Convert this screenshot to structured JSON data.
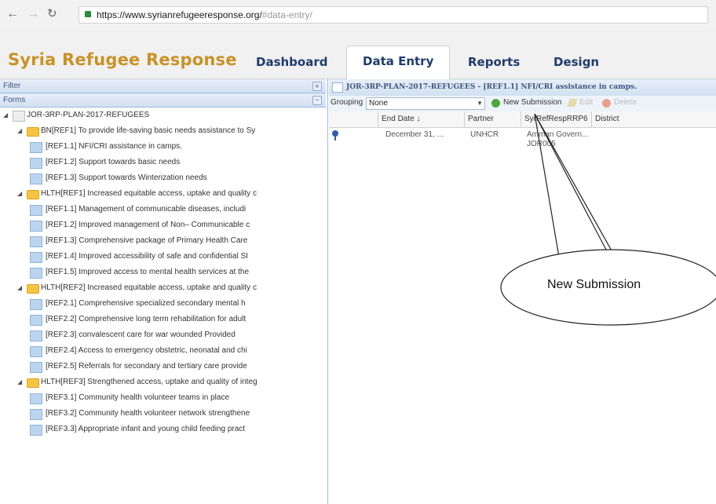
{
  "browser": {
    "url_main": "https://www.syrianrefugeeresponse.org/",
    "url_fragment": "#data-entry/"
  },
  "header": {
    "app_title": "Syria Refugee Response",
    "tabs": [
      "Dashboard",
      "Data Entry",
      "Reports",
      "Design"
    ],
    "active_tab": "Data Entry"
  },
  "left_panel": {
    "filter_title": "Filter",
    "forms_title": "Forms",
    "tree": [
      {
        "level": 0,
        "type": "root",
        "text": "JOR-3RP-PLAN-2017-REFUGEES"
      },
      {
        "level": 1,
        "type": "folder",
        "text": "BN[REF1] To provide life-saving basic needs assistance to Sy"
      },
      {
        "level": 2,
        "type": "form",
        "text": "[REF1.1] NFI/CRI assistance in camps."
      },
      {
        "level": 2,
        "type": "form",
        "text": "[REF1.2] Support towards basic needs"
      },
      {
        "level": 2,
        "type": "form",
        "text": "[REF1.3] Support towards Winterization needs"
      },
      {
        "level": 1,
        "type": "folder",
        "text": "HLTH[REF1] Increased equitable access, uptake and quality c"
      },
      {
        "level": 2,
        "type": "form",
        "text": "[REF1.1] Management of communicable diseases, includi"
      },
      {
        "level": 2,
        "type": "form",
        "text": "[REF1.2] Improved management of Non– Communicable c"
      },
      {
        "level": 2,
        "type": "form",
        "text": "[REF1.3] Comprehensive package of Primary Health Care"
      },
      {
        "level": 2,
        "type": "form",
        "text": "[REF1.4] Improved accessibility of safe and confidential SI"
      },
      {
        "level": 2,
        "type": "form",
        "text": "[REF1.5] Improved access to mental health services at the"
      },
      {
        "level": 1,
        "type": "folder",
        "text": "HLTH[REF2] Increased equitable access, uptake and quality c"
      },
      {
        "level": 2,
        "type": "form",
        "text": "[REF2.1] Comprehensive specialized secondary mental h"
      },
      {
        "level": 2,
        "type": "form",
        "text": "[REF2.2] Comprehensive long term rehabilitation for adult"
      },
      {
        "level": 2,
        "type": "form",
        "text": "[REF2.3] convalescent care for war wounded Provided"
      },
      {
        "level": 2,
        "type": "form",
        "text": "[REF2.4] Access to emergency obstetric, neonatal and chi"
      },
      {
        "level": 2,
        "type": "form",
        "text": "[REF2.5] Referrals for secondary and tertiary care provide"
      },
      {
        "level": 1,
        "type": "folder",
        "text": "HLTH[REF3] Strengthened access, uptake and quality of integ"
      },
      {
        "level": 2,
        "type": "form",
        "text": "[REF3.1] Community health volunteer teams in place"
      },
      {
        "level": 2,
        "type": "form",
        "text": "[REF3.2] Community health volunteer network strengthene"
      },
      {
        "level": 2,
        "type": "form",
        "text": "[REF3.3] Appropriate infant and young child feeding pract"
      }
    ]
  },
  "right_panel": {
    "title": "JOR-3RP-PLAN-2017-REFUGEES - [REF1.1] NFI/CRI assistance in camps.",
    "grouping_label": "Grouping",
    "grouping_value": "None",
    "new_submission_label": "New Submission",
    "edit_label": "Edit",
    "delete_label": "Delete",
    "columns": [
      "End Date ↓",
      "Partner",
      "SyrRefRespRRP6",
      "District"
    ],
    "rows": [
      {
        "end_date": "December 31, ...",
        "partner": "UNHCR",
        "rrp6_line1": "Amman Govern...",
        "rrp6_line2": "JOR005",
        "district": ""
      }
    ]
  },
  "callout": {
    "label": "New Submission"
  }
}
